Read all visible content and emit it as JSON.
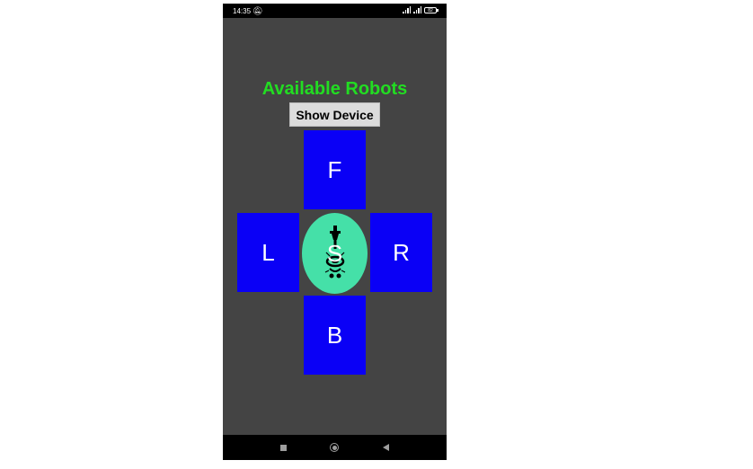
{
  "status_bar": {
    "time": "14:35",
    "battery": "82",
    "icons": [
      "mute-icon",
      "signal-icon",
      "signal-icon",
      "battery-icon"
    ]
  },
  "main": {
    "title": "Available Robots",
    "show_device_label": "Show Device",
    "controls": {
      "forward": "F",
      "left": "L",
      "stop": "S",
      "right": "R",
      "back": "B"
    }
  },
  "colors": {
    "background": "#444444",
    "title": "#22dd22",
    "direction_button": "#0a00f6",
    "stop_button": "#45e0a8"
  },
  "nav_bar": {
    "icons": [
      "recents-icon",
      "home-icon",
      "back-icon"
    ]
  }
}
